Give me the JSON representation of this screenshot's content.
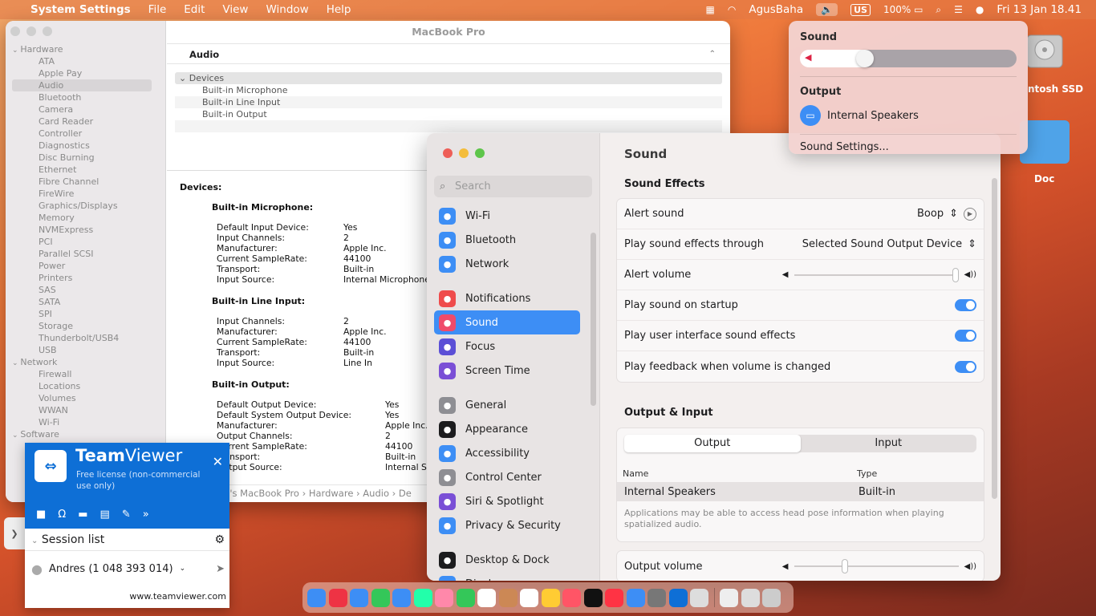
{
  "menubar": {
    "apple": "",
    "app": "System Settings",
    "menus": [
      "File",
      "Edit",
      "View",
      "Window",
      "Help"
    ],
    "user": "AgusBaha",
    "keyboard": "US",
    "battery": "100%",
    "datetime": "Fri 13 Jan  18.41"
  },
  "sysinfo": {
    "title": "MacBook Pro",
    "column": "Audio",
    "tree": [
      {
        "group": "Hardware",
        "items": [
          "ATA",
          "Apple Pay",
          "Audio",
          "Bluetooth",
          "Camera",
          "Card Reader",
          "Controller",
          "Diagnostics",
          "Disc Burning",
          "Ethernet",
          "Fibre Channel",
          "FireWire",
          "Graphics/Displays",
          "Memory",
          "NVMExpress",
          "PCI",
          "Parallel SCSI",
          "Power",
          "Printers",
          "SAS",
          "SATA",
          "SPI",
          "Storage",
          "Thunderbolt/USB4",
          "USB"
        ]
      },
      {
        "group": "Network",
        "items": [
          "Firewall",
          "Locations",
          "Volumes",
          "WWAN",
          "Wi-Fi"
        ]
      },
      {
        "group": "Software",
        "items": []
      }
    ],
    "devices_header": "Devices",
    "devices": [
      "Built-in Microphone",
      "Built-in Line Input",
      "Built-in Output"
    ],
    "detail_title": "Devices:",
    "mic": {
      "title": "Built-in Microphone:",
      "rows": [
        [
          "Default Input Device:",
          "Yes"
        ],
        [
          "Input Channels:",
          "2"
        ],
        [
          "Manufacturer:",
          "Apple Inc."
        ],
        [
          "Current SampleRate:",
          "44100"
        ],
        [
          "Transport:",
          "Built-in"
        ],
        [
          "Input Source:",
          "Internal Microphone"
        ]
      ]
    },
    "line": {
      "title": "Built-in Line Input:",
      "rows": [
        [
          "Input Channels:",
          "2"
        ],
        [
          "Manufacturer:",
          "Apple Inc."
        ],
        [
          "Current SampleRate:",
          "44100"
        ],
        [
          "Transport:",
          "Built-in"
        ],
        [
          "Input Source:",
          "Line In"
        ]
      ]
    },
    "out": {
      "title": "Built-in Output:",
      "rows": [
        [
          "Default Output Device:",
          "Yes"
        ],
        [
          "Default System Output Device:",
          "Yes"
        ],
        [
          "Manufacturer:",
          "Apple Inc."
        ],
        [
          "Output Channels:",
          "2"
        ],
        [
          "Current SampleRate:",
          "44100"
        ],
        [
          "Transport:",
          "Built-in"
        ],
        [
          "Output Source:",
          "Internal Sp"
        ]
      ]
    },
    "path": "ha's MacBook Pro › Hardware › Audio › De"
  },
  "settings": {
    "search_placeholder": "Search",
    "nav": [
      {
        "label": "Wi-Fi",
        "color": "#3d8ef5",
        "icon": "wifi-icon"
      },
      {
        "label": "Bluetooth",
        "color": "#3d8ef5",
        "icon": "bluetooth-icon"
      },
      {
        "label": "Network",
        "color": "#3d8ef5",
        "icon": "globe-icon"
      },
      {
        "label": "Notifications",
        "color": "#ef4b4b",
        "icon": "bell-icon"
      },
      {
        "label": "Sound",
        "color": "#ef4b6b",
        "icon": "speaker-icon"
      },
      {
        "label": "Focus",
        "color": "#5b4fd6",
        "icon": "moon-icon"
      },
      {
        "label": "Screen Time",
        "color": "#7a4fd6",
        "icon": "hourglass-icon"
      },
      {
        "label": "General",
        "color": "#8e8e93",
        "icon": "gear-icon"
      },
      {
        "label": "Appearance",
        "color": "#1c1c1e",
        "icon": "appearance-icon"
      },
      {
        "label": "Accessibility",
        "color": "#3d8ef5",
        "icon": "accessibility-icon"
      },
      {
        "label": "Control Center",
        "color": "#8e8e93",
        "icon": "control-center-icon"
      },
      {
        "label": "Siri & Spotlight",
        "color": "#7a4fd6",
        "icon": "siri-icon"
      },
      {
        "label": "Privacy & Security",
        "color": "#3d8ef5",
        "icon": "hand-icon"
      },
      {
        "label": "Desktop & Dock",
        "color": "#1c1c1e",
        "icon": "dock-icon"
      },
      {
        "label": "Displays",
        "color": "#3d8ef5",
        "icon": "display-icon"
      }
    ],
    "title": "Sound",
    "effects_header": "Sound Effects",
    "alert_sound_label": "Alert sound",
    "alert_sound_value": "Boop",
    "play_through_label": "Play sound effects through",
    "play_through_value": "Selected Sound Output Device",
    "alert_volume_label": "Alert volume",
    "alert_volume_level": 1.0,
    "startup_label": "Play sound on startup",
    "startup_on": true,
    "ui_effects_label": "Play user interface sound effects",
    "ui_effects_on": true,
    "feedback_label": "Play feedback when volume is changed",
    "feedback_on": true,
    "io_header": "Output & Input",
    "tab_output": "Output",
    "tab_input": "Input",
    "col_name": "Name",
    "col_type": "Type",
    "device_name": "Internal Speakers",
    "device_type": "Built-in",
    "note": "Applications may be able to access head pose information when playing spatialized audio.",
    "output_volume_label": "Output volume",
    "output_volume_level": 0.3
  },
  "popover": {
    "sound_label": "Sound",
    "volume_level": 0.3,
    "output_label": "Output",
    "device": "Internal Speakers",
    "settings_link": "Sound Settings..."
  },
  "desktop": {
    "ssd_label": "ntosh SSD",
    "doc_label": "Doc"
  },
  "teamviewer": {
    "brand_a": "Team",
    "brand_b": "Viewer",
    "license": "Free license (non-commercial use only)",
    "session_list": "Session list",
    "user": "Andres (1 048 393 014)",
    "footer": "www.teamviewer.com"
  }
}
